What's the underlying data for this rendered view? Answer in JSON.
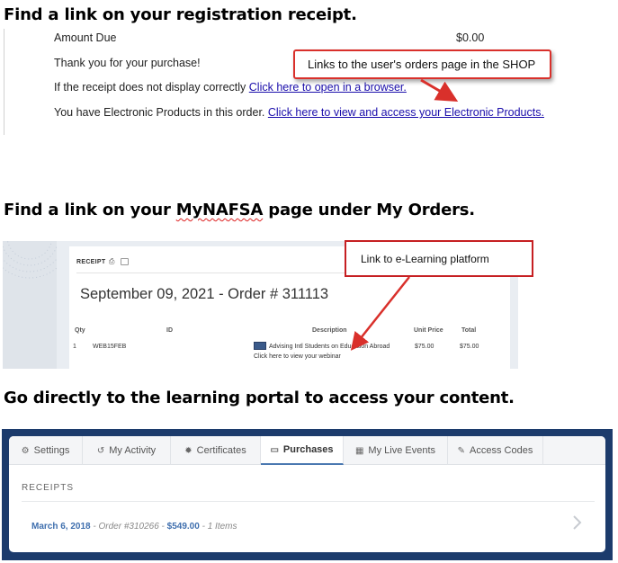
{
  "headings": {
    "receipt": "Find a link on your registration receipt.",
    "mynafsa_prefix": "Find a link on your ",
    "mynafsa_word": "MyNAFSA",
    "mynafsa_suffix": " page under My Orders.",
    "portal": "Go directly to the learning portal to access your content."
  },
  "receipt": {
    "amount_label": "Amount Due",
    "amount_value": "$0.00",
    "thanks": "Thank you for your purchase!",
    "display_prefix": "If the receipt does not display correctly ",
    "display_link": "Click here to open in a browser.",
    "electronic_prefix": "You have Electronic Products in this order. ",
    "electronic_link": "Click here to view and access your Electronic Products.",
    "callout": "Links to the user's orders page in the SHOP"
  },
  "order": {
    "receipt_label": "RECEIPT",
    "title": "September 09, 2021 - Order # 311113",
    "columns": {
      "qty": "Qty",
      "id": "ID",
      "description": "Description",
      "unit_price": "Unit Price",
      "total": "Total"
    },
    "row": {
      "qty": "1",
      "id": "WEB15FEB",
      "description": "Advising Intl Students on Education Abroad",
      "link": "Click here to view your webinar",
      "unit_price": "$75.00",
      "total": "$75.00"
    },
    "callout": "Link to e-Learning platform"
  },
  "portal": {
    "tabs": [
      {
        "label": "Settings",
        "icon": "gear-icon",
        "glyph": "⚙"
      },
      {
        "label": "My Activity",
        "icon": "history-icon",
        "glyph": "↺"
      },
      {
        "label": "Certificates",
        "icon": "certificate-icon",
        "glyph": "✹"
      },
      {
        "label": "Purchases",
        "icon": "credit-card-icon",
        "glyph": "▭"
      },
      {
        "label": "My Live Events",
        "icon": "calendar-icon",
        "glyph": "▦"
      },
      {
        "label": "Access Codes",
        "icon": "edit-icon",
        "glyph": "✎"
      }
    ],
    "active_tab": "Purchases",
    "receipts_label": "RECEIPTS",
    "receipt_row": {
      "date": "March 6, 2018",
      "order": " - Order #310266 - ",
      "price": "$549.00",
      "items": " - 1 Items"
    }
  },
  "colors": {
    "callout_border": "#d9302b",
    "link_blue": "#1a0dab",
    "portal_frame": "#1c3b6c",
    "portal_accent": "#3f6fae"
  }
}
